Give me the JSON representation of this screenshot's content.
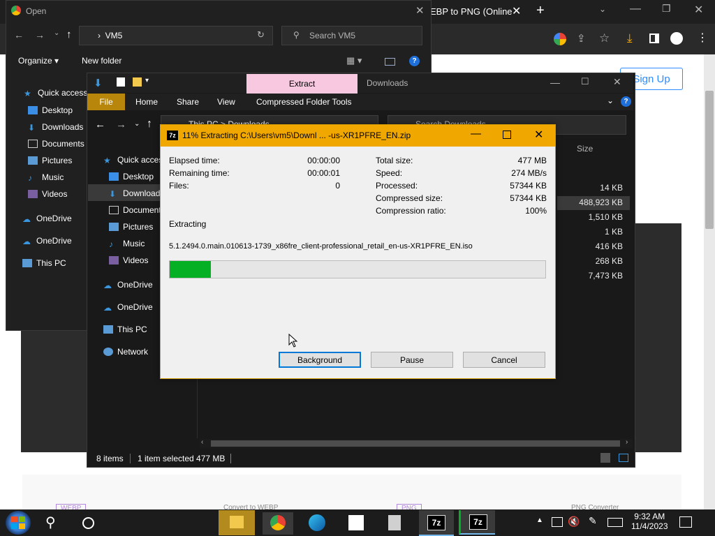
{
  "browser": {
    "open_dialog_title": "Open",
    "tab_title": "EBP to PNG (Online",
    "sign_up": "Sign Up",
    "footer_left": "WEBP",
    "footer_mid": "Convert to WEBP",
    "footer_right_tag": "PNG",
    "footer_right": "PNG Converter"
  },
  "open_dialog": {
    "path": "VM5",
    "search_placeholder": "Search VM5",
    "organize": "Organize",
    "new_folder": "New folder",
    "nav": [
      "Quick access",
      "Desktop",
      "Downloads",
      "Documents",
      "Pictures",
      "Music",
      "Videos",
      "OneDrive",
      "OneDrive",
      "This PC"
    ]
  },
  "explorer": {
    "ribbon_extract": "Extract",
    "title": "Downloads",
    "tabs": [
      "File",
      "Home",
      "Share",
      "View",
      "Compressed Folder Tools"
    ],
    "address": "This PC  >  Downloads",
    "search_placeholder": "Search Downloads",
    "column_size": "Size",
    "nav": [
      "Quick access",
      "Desktop",
      "Downloads",
      "Documents",
      "Pictures",
      "Music",
      "Videos",
      "OneDrive",
      "OneDrive",
      "This PC",
      "Network"
    ],
    "sizes": [
      "14 KB",
      "488,923 KB",
      "1,510 KB",
      "1 KB",
      "416 KB",
      "268 KB",
      "7,473 KB"
    ],
    "status_items": "8 items",
    "status_selected": "1 item selected  477 MB"
  },
  "progress_dialog": {
    "title": "11% Extracting C:\\Users\\vm5\\Downl ... -us-XR1PFRE_EN.zip",
    "left": [
      {
        "label": "Elapsed time:",
        "value": "00:00:00"
      },
      {
        "label": "Remaining time:",
        "value": "00:00:01"
      },
      {
        "label": "Files:",
        "value": "0"
      }
    ],
    "right": [
      {
        "label": "Total size:",
        "value": "477 MB"
      },
      {
        "label": "Speed:",
        "value": "274 MB/s"
      },
      {
        "label": "Processed:",
        "value": "57344 KB"
      },
      {
        "label": "Compressed size:",
        "value": "57344 KB"
      },
      {
        "label": "Compression ratio:",
        "value": "100%"
      }
    ],
    "status": "Extracting",
    "file": "5.1.2494.0.main.010613-1739_x86fre_client-professional_retail_en-us-XR1PFRE_EN.iso",
    "progress_fraction": 0.11,
    "buttons": {
      "background": "Background",
      "pause": "Pause",
      "cancel": "Cancel"
    }
  },
  "taskbar": {
    "time": "9:32 AM",
    "date": "11/4/2023",
    "sevenzip_label": "7z"
  },
  "colors": {
    "dialog_title": "#f0a800",
    "progress": "#06b025",
    "file_tab": "#b8860b",
    "extract_tab": "#f8c8e0"
  }
}
